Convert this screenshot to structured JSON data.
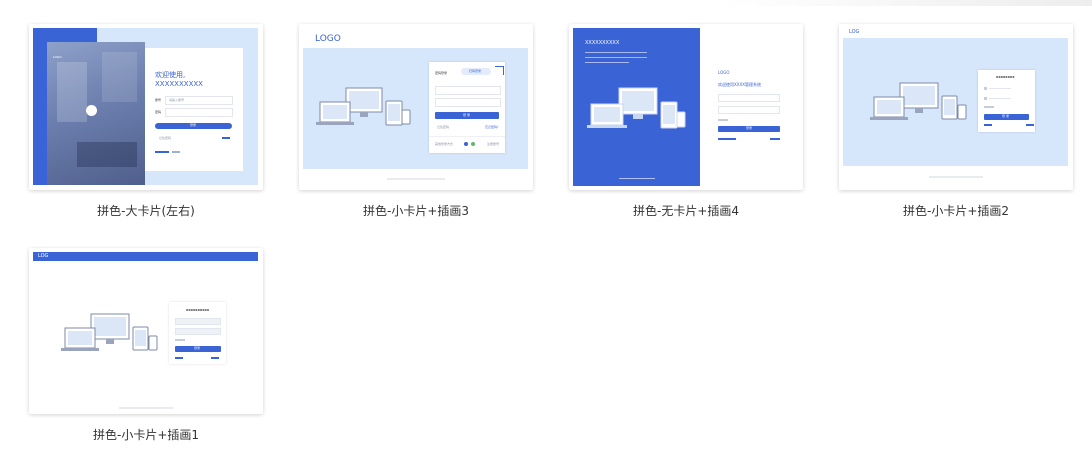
{
  "templates": [
    {
      "caption": "拼色-大卡片(左右)",
      "preview": {
        "logo": "LOGO",
        "welcome": "欢迎使用,",
        "app_name": "XXXXXXXXXX",
        "field1_label": "账号",
        "field2_label": "密码",
        "field_placeholder": "请输入账号",
        "footer_text": "记住密码",
        "button_label": "登录"
      }
    },
    {
      "caption": "拼色-小卡片+插画3",
      "preview": {
        "logo": "LOGO",
        "form_title": "密码登录",
        "tab_label": "扫码登录",
        "button_label": "登 录",
        "remember": "记住密码",
        "forgot": "忘记密码?",
        "footer_left": "其他登录方式",
        "footer_right": "注册账号"
      }
    },
    {
      "caption": "拼色-无卡片+插画4",
      "preview": {
        "banner_title": "XXXXXXXXXX",
        "logo": "LOGO",
        "welcome": "欢迎使用XXXX管理系统",
        "button_label": "登录"
      }
    },
    {
      "caption": "拼色-小卡片+插画2",
      "preview": {
        "logo": "LOG",
        "form_title": "XXXXXXXX",
        "button_label": "登 录"
      }
    },
    {
      "caption": "拼色-小卡片+插画1",
      "preview": {
        "logo": "LOG",
        "form_title": "XXXXXXXXXX",
        "button_label": "登录"
      }
    }
  ],
  "colors": {
    "brand_blue": "#3a63d6",
    "light_blue": "#d6e6fb",
    "caption_text": "#333333"
  }
}
